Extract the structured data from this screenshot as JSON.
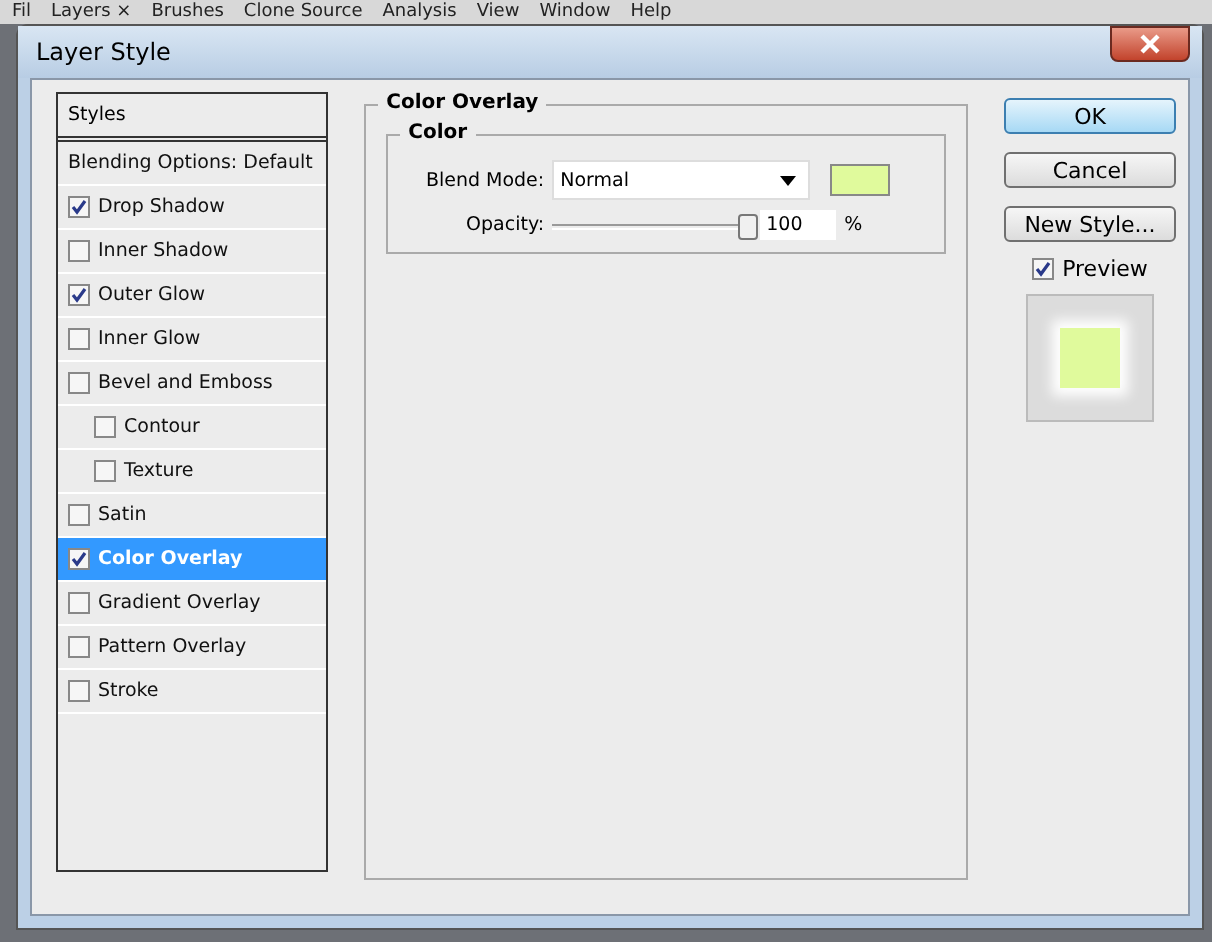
{
  "background_app": {
    "menu_items": [
      "Fil",
      "Layers ×",
      "Brushes",
      "Clone Source",
      "Analysis",
      "View",
      "Window",
      "Help"
    ]
  },
  "window": {
    "title": "Layer Style"
  },
  "styles_list": {
    "header": "Styles",
    "items": [
      {
        "kind": "plain",
        "label": "Blending Options: Default",
        "selected": false
      },
      {
        "kind": "check",
        "label": "Drop Shadow",
        "checked": true,
        "selected": false
      },
      {
        "kind": "check",
        "label": "Inner Shadow",
        "checked": false,
        "selected": false
      },
      {
        "kind": "check",
        "label": "Outer Glow",
        "checked": true,
        "selected": false
      },
      {
        "kind": "check",
        "label": "Inner Glow",
        "checked": false,
        "selected": false
      },
      {
        "kind": "check",
        "label": "Bevel and Emboss",
        "checked": false,
        "selected": false,
        "children": [
          {
            "kind": "check",
            "label": "Contour",
            "checked": false,
            "selected": false
          },
          {
            "kind": "check",
            "label": "Texture",
            "checked": false,
            "selected": false
          }
        ]
      },
      {
        "kind": "check",
        "label": "Satin",
        "checked": false,
        "selected": false
      },
      {
        "kind": "check",
        "label": "Color Overlay",
        "checked": true,
        "selected": true
      },
      {
        "kind": "check",
        "label": "Gradient Overlay",
        "checked": false,
        "selected": false
      },
      {
        "kind": "check",
        "label": "Pattern Overlay",
        "checked": false,
        "selected": false
      },
      {
        "kind": "check",
        "label": "Stroke",
        "checked": false,
        "selected": false
      }
    ]
  },
  "panel": {
    "title": "Color Overlay",
    "group_title": "Color",
    "blend_mode_label": "Blend Mode:",
    "blend_mode": "Normal",
    "color": "#e0fa9c",
    "opacity_label": "Opacity:",
    "opacity": {
      "level": 0.98
    },
    "opacity_value": "100",
    "opacity_unit": "%"
  },
  "buttons": [
    {
      "label": "OK",
      "default": true
    },
    {
      "label": "Cancel",
      "default": false
    },
    {
      "label": "New Style...",
      "default": false
    }
  ],
  "preview": {
    "label": "Preview",
    "checked": true,
    "color": "#e0fa9c"
  }
}
